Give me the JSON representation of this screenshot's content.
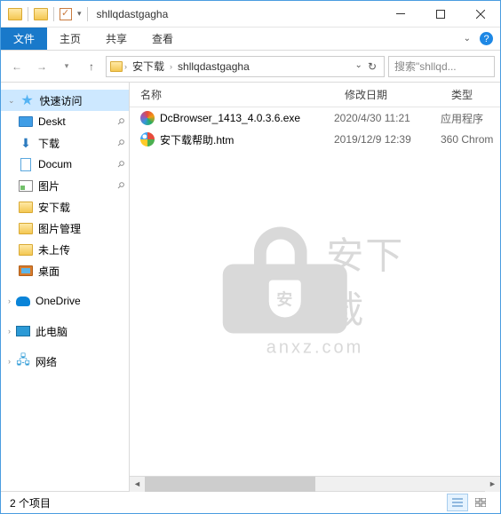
{
  "window": {
    "title": "shllqdastgagha"
  },
  "ribbon": {
    "tabs": {
      "file": "文件",
      "home": "主页",
      "share": "共享",
      "view": "查看"
    }
  },
  "breadcrumb": {
    "seg1": "安下载",
    "seg2": "shllqdastgagha"
  },
  "search": {
    "placeholder": "搜索\"shllqd..."
  },
  "sidebar": {
    "quick_access": "快速访问",
    "desktop": "Deskt",
    "downloads": "下载",
    "documents": "Docum",
    "pictures": "图片",
    "anxiazai": "安下载",
    "picmgr": "图片管理",
    "unuploaded": "未上传",
    "desk_cn": "桌面",
    "onedrive": "OneDrive",
    "thispc": "此电脑",
    "network": "网络"
  },
  "columns": {
    "name": "名称",
    "date": "修改日期",
    "type": "类型"
  },
  "files": [
    {
      "name": "DcBrowser_1413_4.0.3.6.exe",
      "date": "2020/4/30 11:21",
      "type": "应用程序"
    },
    {
      "name": "安下载帮助.htm",
      "date": "2019/12/9 12:39",
      "type": "360 Chrom"
    }
  ],
  "watermark": {
    "text": "安下载",
    "shield": "安",
    "url": "anxz.com"
  },
  "statusbar": {
    "count": "2 个项目"
  }
}
